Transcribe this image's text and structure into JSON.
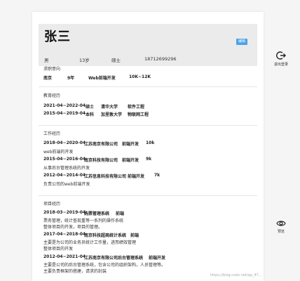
{
  "profile": {
    "name": "张三",
    "edit_label": "编辑",
    "gender": "男",
    "age": "13岁",
    "degree": "硕士",
    "phone": "18712699296"
  },
  "job_intent": {
    "title": "求职意向",
    "city": "南京",
    "time": "9年",
    "position": "Web前端开发",
    "salary": "10K~12K"
  },
  "education": {
    "title": "教育经历",
    "items": [
      {
        "period": "2021-04~2022-04",
        "degree": "硕士",
        "school": "清华大学",
        "major": "软件工程"
      },
      {
        "period": "2015-04~2019-04",
        "degree": "本科",
        "school": "加里敦大学",
        "major": "物联网工程"
      }
    ]
  },
  "work": {
    "title": "工作经历",
    "items": [
      {
        "period": "2018-04~2020-04",
        "company": "江苏南京有限公司",
        "role": "前端开发",
        "salary": "10k",
        "desc": "web前端的开发"
      },
      {
        "period": "2015-04~2016-04",
        "company": "南京科技有限公司",
        "role": "前端开发",
        "salary": "9k",
        "desc": "从事后台管理系统的开发"
      },
      {
        "period": "2012-04~2014-04",
        "company": "江苏信息科技有限公司",
        "role": "前端开发",
        "salary": "7k",
        "desc": "负责公司的web前端开发"
      }
    ]
  },
  "projects": {
    "title": "项目经历",
    "items": [
      {
        "period": "2018-03~2019-04",
        "name": "购票管理系统",
        "role": "前端",
        "desc1": "票务管理，统计查现重等一系列的操作系统",
        "desc2": "整体项目的开发，项目的管理。"
      },
      {
        "period": "2017-04~2018-04",
        "name": "南京科技超商统计系统",
        "role": "前端",
        "desc1": "主要是为公司的业务员统计工作量，进而绩效管理",
        "desc2": "整体项目的开发"
      },
      {
        "period": "2012-04~2021-04",
        "name": "江苏南京有限公司后台管理系统",
        "role": "前端开发",
        "desc1": "主要是公司的后台管理系统，包含公司的组织架构，人员管理等。",
        "desc2": "主要负责框架的搭建，请求的封装"
      }
    ]
  },
  "actions": {
    "logout_label": "退出登录",
    "preview_label": "预览"
  },
  "watermark": "https://blog.csdn.net/qq_47..."
}
